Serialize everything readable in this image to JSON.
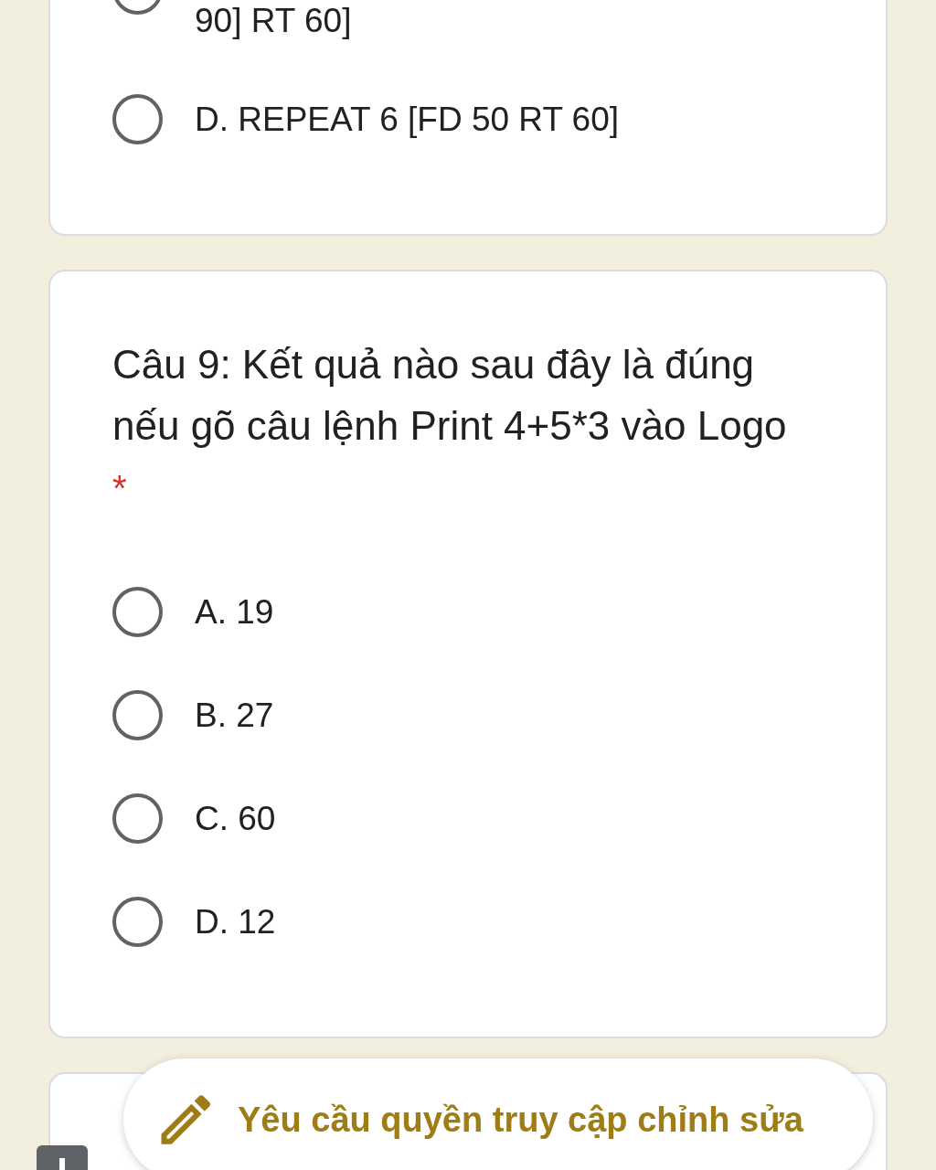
{
  "cards": [
    {
      "options": [
        {
          "text": "90] RT 60]",
          "selected": false,
          "cut_off": true
        },
        {
          "text": "D. REPEAT 6 [FD 50 RT 60]",
          "selected": false,
          "cut_off": false
        }
      ]
    },
    {
      "question": "Câu 9: Kết quả nào sau đây là đúng nếu gõ câu lệnh Print 4+5*3 vào Logo",
      "required_mark": "*",
      "options": [
        {
          "text": "A. 19",
          "selected": false,
          "cut_off": false
        },
        {
          "text": "B. 27",
          "selected": false,
          "cut_off": false
        },
        {
          "text": "C. 60",
          "selected": false,
          "cut_off": false
        },
        {
          "text": "D. 12",
          "selected": false,
          "cut_off": false
        }
      ]
    }
  ],
  "request_edit_button": {
    "label": "Yêu cầu quyền truy cập chỉnh sửa"
  }
}
